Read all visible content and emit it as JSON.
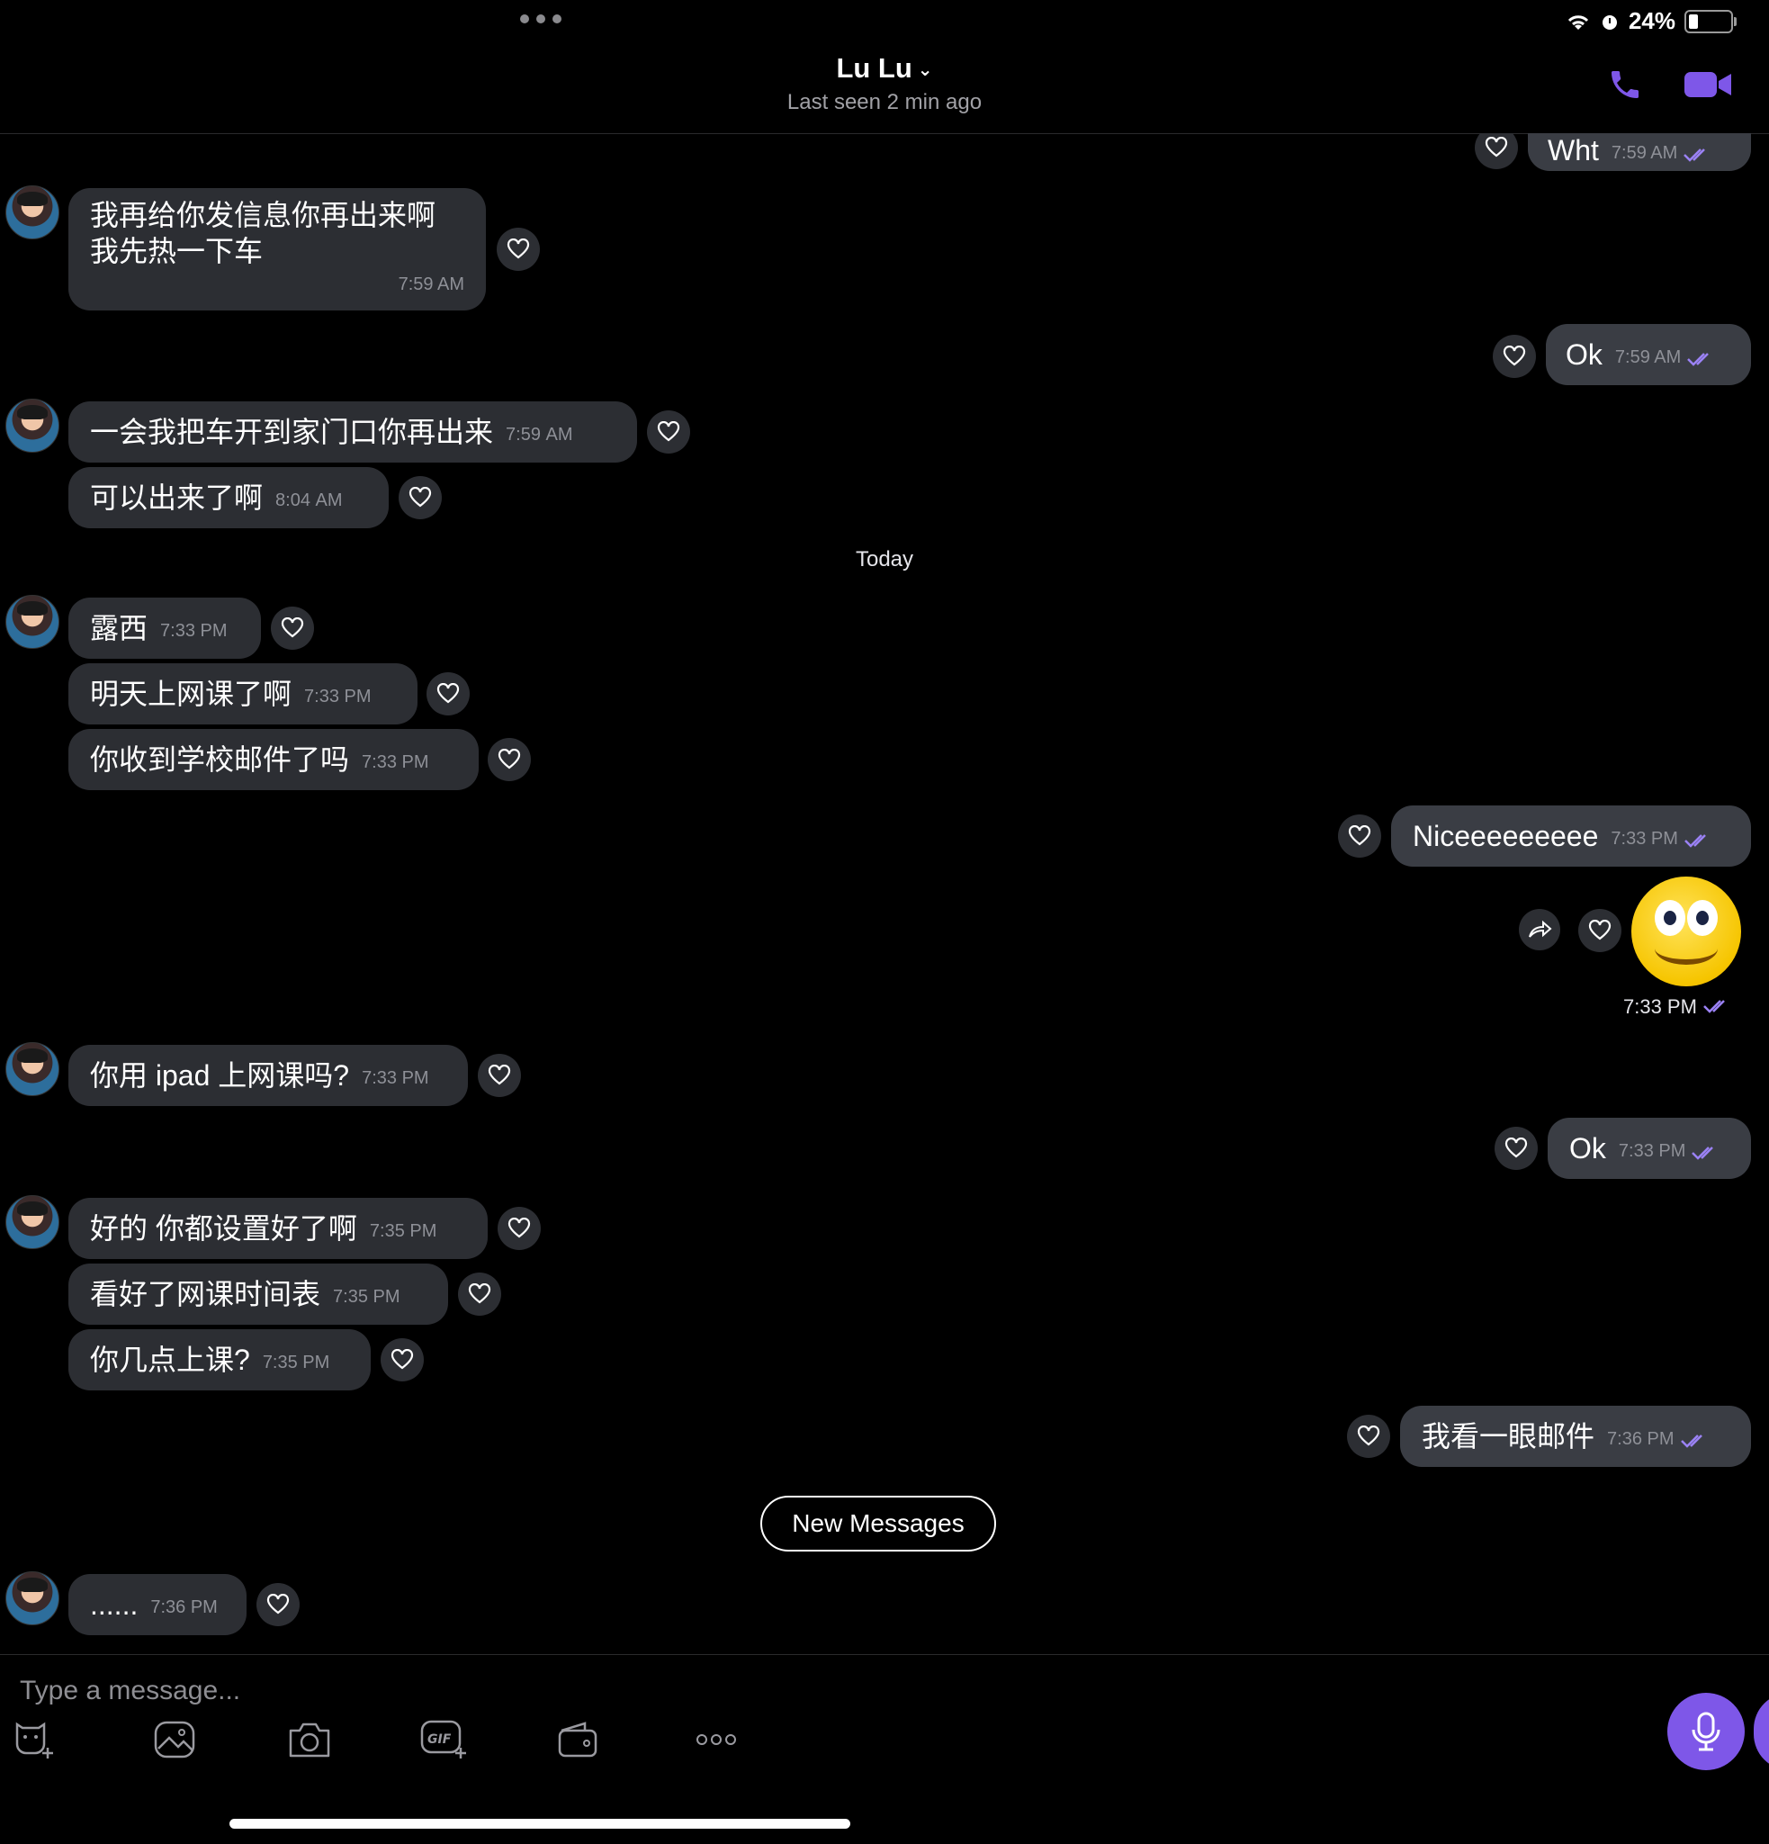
{
  "status": {
    "battery": "24%"
  },
  "header": {
    "name": "Lu Lu",
    "last_seen": "Last seen 2 min ago"
  },
  "messages": {
    "m0": {
      "text": "Wht",
      "time": "7:59 AM"
    },
    "m1": {
      "line1": "我再给你发信息你再出来啊",
      "line2": "我先热一下车",
      "time": "7:59 AM"
    },
    "m2": {
      "text": "Ok",
      "time": "7:59 AM"
    },
    "m3": {
      "text": "一会我把车开到家门口你再出来",
      "time": "7:59 AM"
    },
    "m4": {
      "text": "可以出来了啊",
      "time": "8:04 AM"
    },
    "day": "Today",
    "m5": {
      "text": "露西",
      "time": "7:33 PM"
    },
    "m6": {
      "text": "明天上网课了啊",
      "time": "7:33 PM"
    },
    "m7": {
      "text": "你收到学校邮件了吗",
      "time": "7:33 PM"
    },
    "m8": {
      "text": "Niceeeeeeeee",
      "time": "7:33 PM"
    },
    "sticker_time": "7:33 PM",
    "m9": {
      "text": "你用 ipad 上网课吗?",
      "time": "7:33 PM"
    },
    "m10": {
      "text": "Ok",
      "time": "7:33 PM"
    },
    "m11": {
      "text": "好的 你都设置好了啊",
      "time": "7:35 PM"
    },
    "m12": {
      "text": "看好了网课时间表",
      "time": "7:35 PM"
    },
    "m13": {
      "text": "你几点上课?",
      "time": "7:35 PM"
    },
    "m14": {
      "text": "我看一眼邮件",
      "time": "7:36 PM"
    },
    "new_messages": "New Messages",
    "m15": {
      "text": "......",
      "time": "7:36 PM"
    }
  },
  "composer": {
    "placeholder": "Type a message..."
  },
  "icons": {
    "call": "phone-icon",
    "video": "video-camera-icon",
    "heart": "heart-outline-icon",
    "forward": "forward-icon",
    "mic": "microphone-icon",
    "sticker": "sticker-add-icon",
    "gallery": "gallery-icon",
    "camera": "camera-icon",
    "gif": "gif-icon",
    "wallet": "wallet-icon",
    "more": "more-icon"
  },
  "colors": {
    "accent": "#7e57e8",
    "bubble_in": "#2c2e33",
    "bubble_out": "#3a3d44",
    "tick": "#9b82f5"
  }
}
